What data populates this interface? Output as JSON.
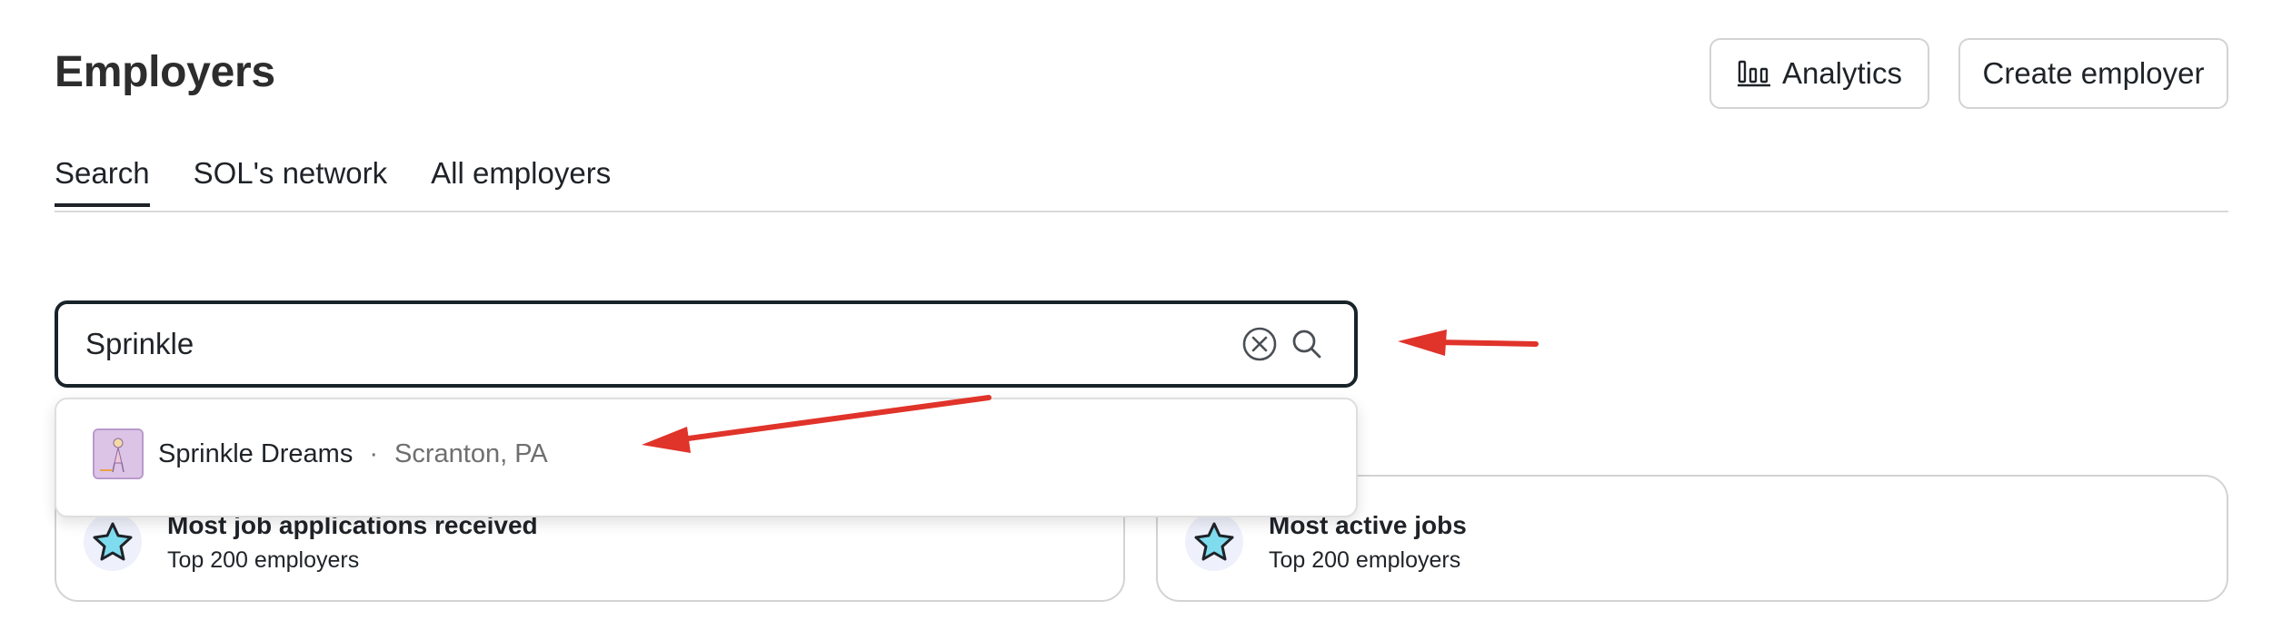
{
  "header": {
    "title": "Employers",
    "analytics_label": "Analytics",
    "create_label": "Create employer"
  },
  "tabs": [
    {
      "label": "Search",
      "active": true
    },
    {
      "label": "SOL's network",
      "active": false
    },
    {
      "label": "All employers",
      "active": false
    }
  ],
  "search": {
    "value": "Sprinkle",
    "clear_icon": "clear-circle-icon",
    "search_icon": "search-icon"
  },
  "dropdown": {
    "results": [
      {
        "name": "Sprinkle Dreams",
        "separator": "·",
        "location": "Scranton, PA",
        "logo_icon": "employer-logo"
      }
    ]
  },
  "cards": [
    {
      "title": "Most job applications received",
      "subtitle": "Top 200 employers",
      "icon": "star-icon"
    },
    {
      "title": "Most active jobs",
      "subtitle": "Top 200 employers",
      "icon": "star-icon"
    }
  ],
  "colors": {
    "annotation_arrow": "#e0332a",
    "star_fill": "#7fdcef",
    "badge_bg": "#eef0fb"
  }
}
